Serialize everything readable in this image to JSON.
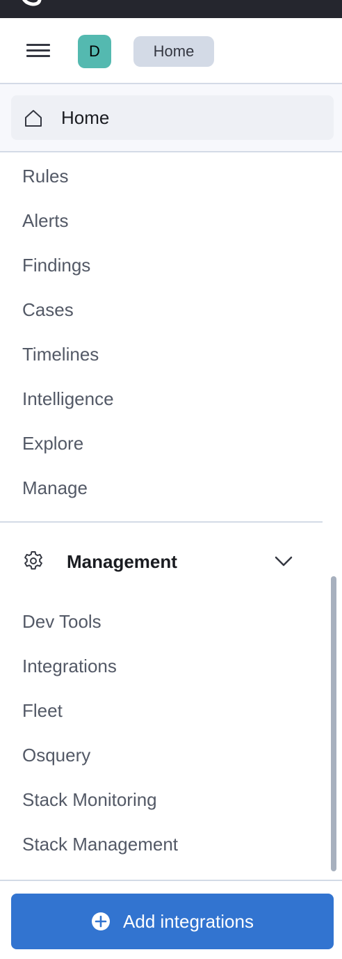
{
  "header": {
    "avatar_letter": "D",
    "breadcrumb": "Home"
  },
  "home": {
    "label": "Home",
    "icon": "home-icon"
  },
  "nav_items": [
    {
      "label": "Rules"
    },
    {
      "label": "Alerts"
    },
    {
      "label": "Findings"
    },
    {
      "label": "Cases"
    },
    {
      "label": "Timelines"
    },
    {
      "label": "Intelligence"
    },
    {
      "label": "Explore"
    },
    {
      "label": "Manage"
    }
  ],
  "management": {
    "title": "Management",
    "icon": "gear-icon",
    "items": [
      {
        "label": "Dev Tools"
      },
      {
        "label": "Integrations"
      },
      {
        "label": "Fleet"
      },
      {
        "label": "Osquery"
      },
      {
        "label": "Stack Monitoring"
      },
      {
        "label": "Stack Management"
      }
    ]
  },
  "footer": {
    "add_button_label": "Add integrations",
    "add_icon": "plus-circle-icon"
  },
  "colors": {
    "topbar": "#25262e",
    "avatar": "#54b9b0",
    "accent": "#3274d0",
    "nav_text": "#535966",
    "divider": "#d3dae6"
  }
}
